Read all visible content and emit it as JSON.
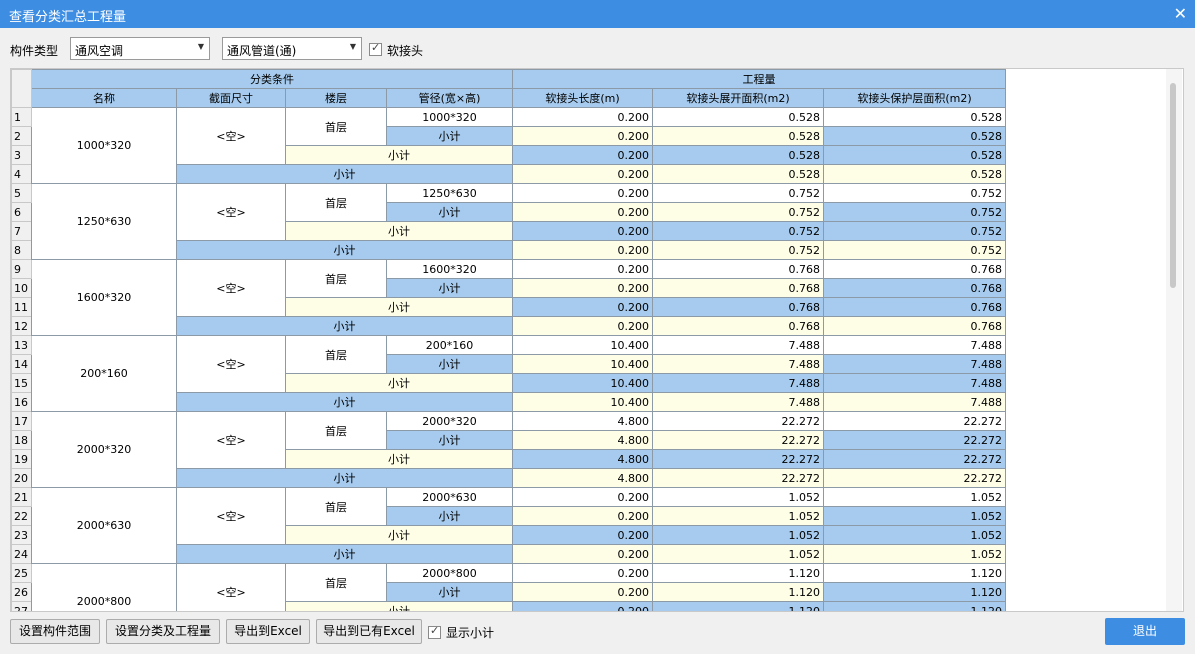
{
  "window": {
    "title": "查看分类汇总工程量"
  },
  "toolbar": {
    "type_label": "构件类型",
    "combo1": "通风空调",
    "combo2": "通风管道(通)",
    "soft_joint_label": "软接头"
  },
  "headers": {
    "group_left": "分类条件",
    "group_right": "工程量",
    "cols": [
      "名称",
      "截面尺寸",
      "楼层",
      "管径(宽×高)",
      "软接头长度(m)",
      "软接头展开面积(m2)",
      "软接头保护层面积(m2)"
    ]
  },
  "groups": [
    {
      "name": "1000*320",
      "section": "<空>",
      "floor": "首层",
      "dia": "1000*320",
      "len": "0.200",
      "area": "0.528",
      "prot": "0.528"
    },
    {
      "name": "1250*630",
      "section": "<空>",
      "floor": "首层",
      "dia": "1250*630",
      "len": "0.200",
      "area": "0.752",
      "prot": "0.752"
    },
    {
      "name": "1600*320",
      "section": "<空>",
      "floor": "首层",
      "dia": "1600*320",
      "len": "0.200",
      "area": "0.768",
      "prot": "0.768"
    },
    {
      "name": "200*160",
      "section": "<空>",
      "floor": "首层",
      "dia": "200*160",
      "len": "10.400",
      "area": "7.488",
      "prot": "7.488"
    },
    {
      "name": "2000*320",
      "section": "<空>",
      "floor": "首层",
      "dia": "2000*320",
      "len": "4.800",
      "area": "22.272",
      "prot": "22.272"
    },
    {
      "name": "2000*630",
      "section": "<空>",
      "floor": "首层",
      "dia": "2000*630",
      "len": "0.200",
      "area": "1.052",
      "prot": "1.052"
    },
    {
      "name": "2000*800",
      "section": "<空>",
      "floor": "首层",
      "dia": "2000*800",
      "len": "0.200",
      "area": "1.120",
      "prot": "1.120"
    }
  ],
  "subtotal_label": "小计",
  "bottom": {
    "btn_range": "设置构件范围",
    "btn_classify": "设置分类及工程量",
    "btn_export": "导出到Excel",
    "btn_export_existing": "导出到已有Excel",
    "show_subtotal_label": "显示小计",
    "btn_exit": "退出"
  }
}
